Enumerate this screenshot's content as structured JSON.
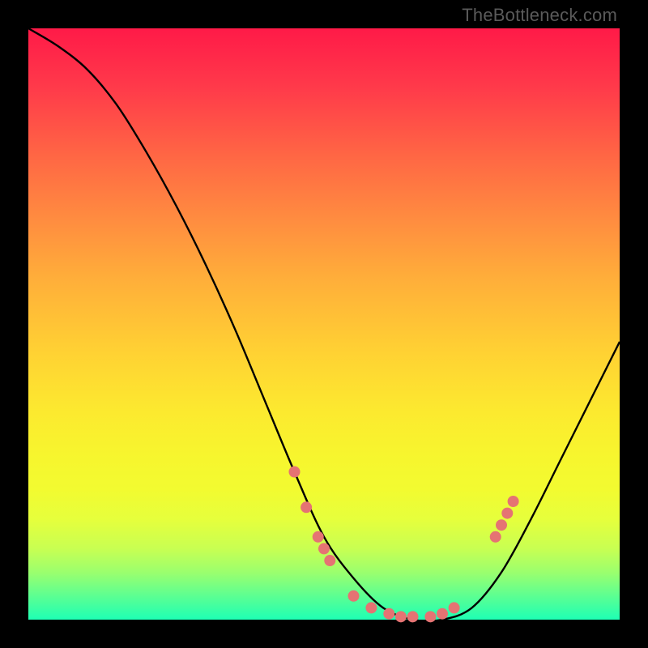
{
  "watermark": "TheBottleneck.com",
  "chart_data": {
    "type": "line",
    "title": "",
    "xlabel": "",
    "ylabel": "",
    "xlim": [
      0,
      100
    ],
    "ylim": [
      0,
      100
    ],
    "x": [
      0,
      5,
      10,
      15,
      20,
      25,
      30,
      35,
      40,
      45,
      50,
      55,
      60,
      65,
      70,
      75,
      80,
      85,
      90,
      95,
      100
    ],
    "values": [
      100,
      97,
      93,
      87,
      79,
      70,
      60,
      49,
      37,
      25,
      14,
      7,
      2,
      0,
      0,
      2,
      8,
      17,
      27,
      37,
      47
    ],
    "curve_note": "V-shaped bottleneck curve; minimum around x≈63–70",
    "scatter_points": [
      {
        "x": 45,
        "y": 25
      },
      {
        "x": 47,
        "y": 19
      },
      {
        "x": 49,
        "y": 14
      },
      {
        "x": 50,
        "y": 12
      },
      {
        "x": 51,
        "y": 10
      },
      {
        "x": 55,
        "y": 4
      },
      {
        "x": 58,
        "y": 2
      },
      {
        "x": 61,
        "y": 1
      },
      {
        "x": 63,
        "y": 0.5
      },
      {
        "x": 65,
        "y": 0.5
      },
      {
        "x": 68,
        "y": 0.5
      },
      {
        "x": 70,
        "y": 1
      },
      {
        "x": 72,
        "y": 2
      },
      {
        "x": 79,
        "y": 14
      },
      {
        "x": 80,
        "y": 16
      },
      {
        "x": 81,
        "y": 18
      },
      {
        "x": 82,
        "y": 20
      }
    ],
    "scatter_color": "#e57373"
  }
}
